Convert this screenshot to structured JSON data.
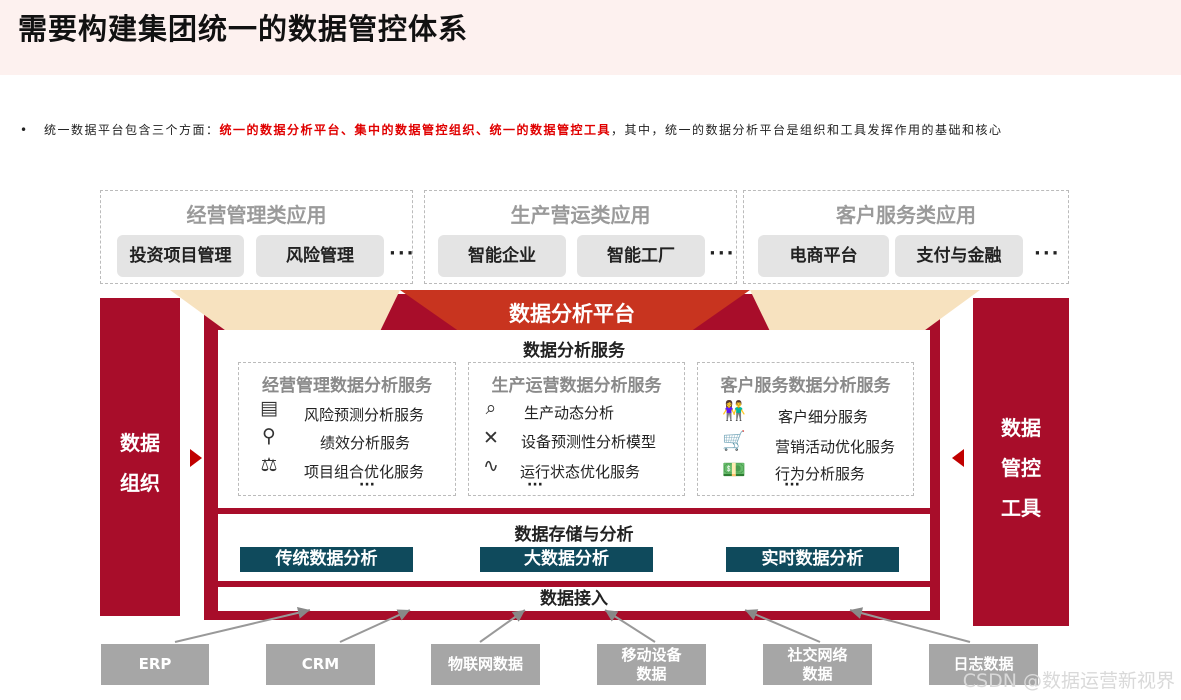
{
  "title": "需要构建集团统一的数据管控体系",
  "intro": {
    "bullet": "•",
    "prefix": "统一数据平台包含三个方面：",
    "highlight": "统一的数据分析平台、集中的数据管控组织、统一的数据管控工具",
    "suffix": "，其中，统一的数据分析平台是组织和工具发挥作用的基础和核心"
  },
  "apps": [
    {
      "title": "经营管理类应用",
      "items": [
        "投资项目管理",
        "风险管理"
      ],
      "more": "···"
    },
    {
      "title": "生产营运类应用",
      "items": [
        "智能企业",
        "智能工厂"
      ],
      "more": "···"
    },
    {
      "title": "客户服务类应用",
      "items": [
        "电商平台",
        "支付与金融"
      ],
      "more": "···"
    }
  ],
  "left_bar": {
    "lines": [
      "数据",
      "组织"
    ]
  },
  "right_bar": {
    "lines": [
      "数据",
      "管控",
      "工具"
    ]
  },
  "platform": {
    "title": "数据分析平台",
    "services_title": "数据分析服务",
    "services": [
      {
        "title": "经营管理数据分析服务",
        "items": [
          {
            "icon": "server-stack-icon",
            "label": "风险预测分析服务"
          },
          {
            "icon": "faucet-icon",
            "label": "绩效分析服务"
          },
          {
            "icon": "scale-icon",
            "label": "项目组合优化服务"
          }
        ],
        "more": "···"
      },
      {
        "title": "生产运营数据分析服务",
        "items": [
          {
            "icon": "magnifier-icon",
            "label": "生产动态分析"
          },
          {
            "icon": "tools-icon",
            "label": "设备预测性分析模型"
          },
          {
            "icon": "process-icon",
            "label": "运行状态优化服务"
          }
        ],
        "more": "···"
      },
      {
        "title": "客户服务数据分析服务",
        "items": [
          {
            "icon": "people-icon",
            "label": "客户细分服务"
          },
          {
            "icon": "cart-icon",
            "label": "营销活动优化服务"
          },
          {
            "icon": "money-icon",
            "label": "行为分析服务"
          }
        ],
        "more": "···"
      }
    ],
    "storage_title": "数据存储与分析",
    "storage_items": [
      "传统数据分析",
      "大数据分析",
      "实时数据分析"
    ],
    "ingest_title": "数据接入"
  },
  "sources": [
    {
      "lines": [
        "ERP"
      ]
    },
    {
      "lines": [
        "CRM"
      ]
    },
    {
      "lines": [
        "物联网数据"
      ]
    },
    {
      "lines": [
        "移动设备",
        "数据"
      ]
    },
    {
      "lines": [
        "社交网络",
        "数据"
      ]
    },
    {
      "lines": [
        "日志数据"
      ]
    }
  ],
  "watermark": "CSDN @数据运营新视界",
  "colors": {
    "brand_red": "#a80d2a",
    "teal": "#0f4a5c",
    "platform_red": "#c0341f",
    "highlight_red": "#e00000"
  }
}
